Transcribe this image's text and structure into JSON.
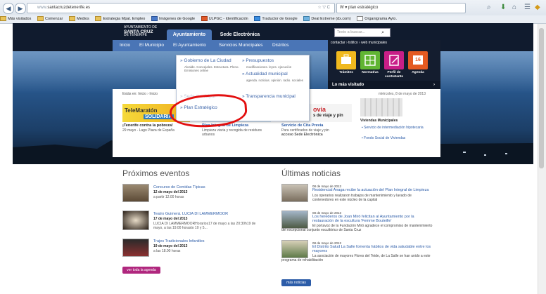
{
  "browser": {
    "url_prefix": "www.",
    "url": "santacruzdetenerife.es",
    "url_suffix": "☆ ▽ C",
    "search_value": "W ▾ plan estratégico",
    "bookmarks": [
      "Más visitados",
      "Comenzar",
      "Medios",
      "Estrategia Mpal. Empleo",
      "Imágenes de Google",
      "ULPGC - Identificación",
      "Traductor de Google",
      "Deal Extreme (dx.com)",
      "Organigrama Ayto."
    ]
  },
  "site": {
    "logo_line1": "AYUNTAMIENTO DE",
    "logo_line2": "SANTA CRUZ",
    "logo_line3": "DE TENERIFE",
    "tab_active": "Ayuntamiento",
    "tab_other": "Sede Electrónica",
    "search_placeholder": "Texto a buscar...",
    "nav": [
      "Inicio",
      "El Municipio",
      "El Ayuntamiento",
      "Servicios Municipales",
      "Distritos"
    ],
    "right_links": "contactar  ›  tráfico  ›  web municipales",
    "tiles": [
      "Trámites",
      "Normativa",
      "Perfil de contratante",
      "Agenda"
    ],
    "agenda_day": "16",
    "mas_visitado": "Lo más visitado",
    "breadcrumb": "Estás en:  Inicio  ›  Inicio",
    "date": "miércoles, 8 de mayo de 2013"
  },
  "dropdown": {
    "gobierno": "» Gobierno de La Ciudad",
    "gobierno_sub": "Alcalde. Concejales. Estructura. Pleno. Emisiones online",
    "presupuestos": "» Presupuestos",
    "presupuestos_sub": "modificaciones. leyes. ejecución",
    "actualidad": "» Actualidad municipal",
    "actualidad_sub": "agenda. noticias. opinión. radio. sociales",
    "transparencia": "» Transparencia municipal",
    "plan": "» Plan Estratégico",
    "hidden_item": "» Sede municipal"
  },
  "feature": {
    "banner_title": "TeleMaratón",
    "banner_brand": "SOLIDARIA",
    "item1_title": "¡Tenerife contra la pobreza!",
    "item1_text": "29 mayo - Lago Plaza de España",
    "item2_title": "Plan Integral de Limpieza",
    "item2_text": "Limpieza viaria y recogida de residuos urbanos",
    "item3_banner": "ovia",
    "item3_banner2": "s de viaje y pin",
    "item3_title": "Servicio de Cita Previa",
    "item3_text": "Para certificados de viaje y pin",
    "item3_text2": "acceso Sede Electrónica",
    "side_title": "Viviendas Municipales",
    "side_link1": "Servicio de intermediación hipotecaria",
    "side_link2": "Fondo Social de Viviendas"
  },
  "events": {
    "heading": "Próximos eventos",
    "items": [
      {
        "title": "Concurso de Comidas Típicas",
        "date": "12 de mayo del 2013",
        "time": "a partir 12.00 horas"
      },
      {
        "title": "Teatro Guimerá. LUCIA DI LAMMERMOOR",
        "date": "17 de mayo del 2013",
        "time": "LUCIA DI LAMMERMOORHorarios17 de mayo a las 20:30h19 de mayo, a las 19.00 horasto 10 y 5..."
      },
      {
        "title": "Trajes Tradicionales Infantiles",
        "date": "19 de mayo del 2013",
        "time": "a las 18.00 horas"
      }
    ],
    "button": "ver toda la agenda"
  },
  "news": {
    "heading": "Últimas noticias",
    "items": [
      {
        "date": "08 de mayo de 2013",
        "title": "Residencial Anaga recibe la actuación del Plan Integral de Limpieza",
        "body": "Los operarios realizaron trabajos de mantenimiento y lavado de contenedores en este núcleo de la capital"
      },
      {
        "date": "08 de mayo de 2013",
        "title": "Los herederos de Joan Miró felicitan al Ayuntamiento por la restauración de la escultura 'Femme Bouteille'",
        "body": "El portavoz de la Fundación Miró agradece el compromiso de mantenimiento del excepcional conjunto escultórico de Santa Cruz"
      },
      {
        "date": "08 de mayo de 2013",
        "title": "El Distrito Salud La Salle fomenta hábitos de vida saludable entre los mayores",
        "body": "La asociación de mayores Flores del Teide, de La Salle se han unido a este programa de rehabilitación"
      }
    ],
    "button": "más noticias"
  },
  "colors": {
    "accent": "#4a75b6",
    "header": "#101b2e",
    "highlight": "#e31010",
    "event_button": "#b0277e"
  }
}
